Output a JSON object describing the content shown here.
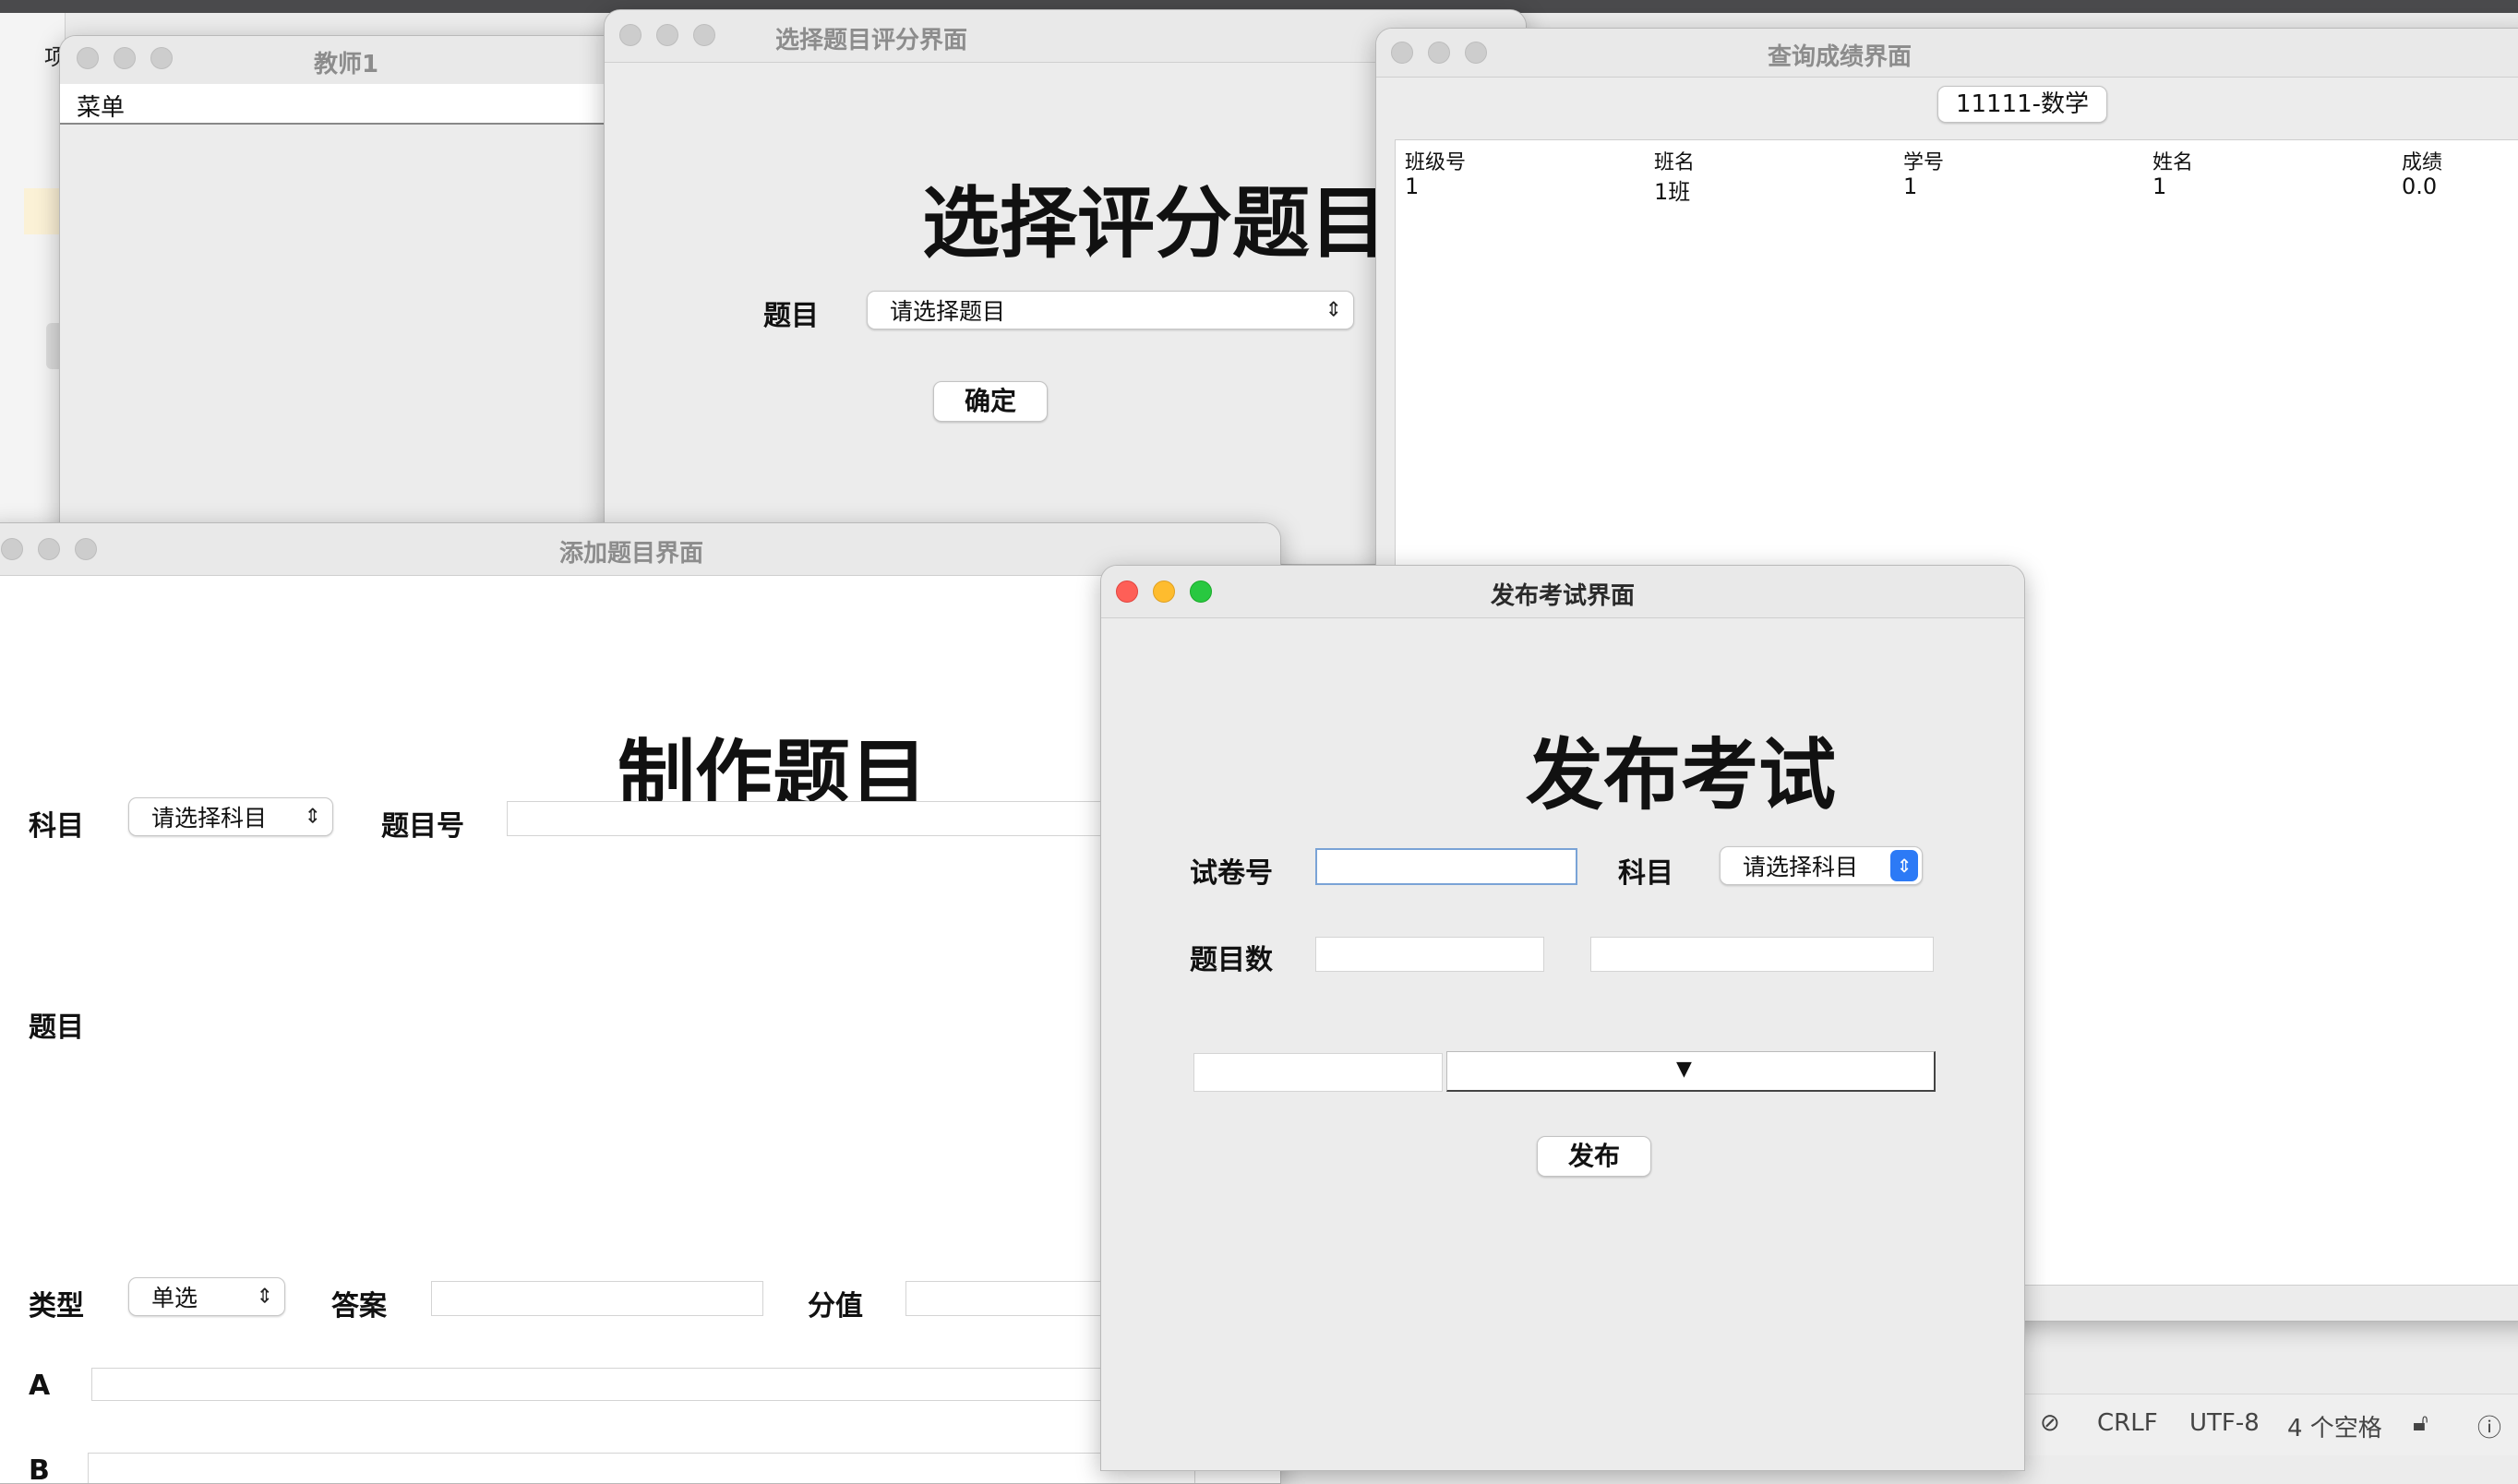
{
  "background": {
    "left_tab_fragment": "项",
    "status_bar": {
      "line_ending": "CRLF",
      "encoding": "UTF-8",
      "indent": "4 个空格"
    }
  },
  "teacher_window": {
    "title": "教师1",
    "menu_label": "菜单"
  },
  "select_question_window": {
    "title": "选择题目评分界面",
    "heading": "选择评分题目",
    "question_label": "题目",
    "question_select": "请选择题目",
    "confirm_button": "确定"
  },
  "query_scores_window": {
    "title": "查询成绩界面",
    "exam_button": "11111-数学",
    "columns": [
      "班级号",
      "班名",
      "学号",
      "姓名",
      "成绩"
    ],
    "rows": [
      [
        "1",
        "1班",
        "1",
        "1",
        "0.0"
      ]
    ]
  },
  "add_question_window": {
    "title": "添加题目界面",
    "heading": "制作题目",
    "subject_label": "科目",
    "subject_select": "请选择科目",
    "question_no_label": "题目号",
    "question_label": "题目",
    "type_label": "类型",
    "type_select": "单选",
    "answer_label": "答案",
    "score_label": "分值",
    "option_a_label": "A",
    "option_b_label": "B"
  },
  "publish_exam_window": {
    "title": "发布考试界面",
    "heading": "发布考试",
    "paper_no_label": "试卷号",
    "subject_label": "科目",
    "subject_select": "请选择科目",
    "question_count_label": "题目数",
    "publish_button": "发布"
  }
}
